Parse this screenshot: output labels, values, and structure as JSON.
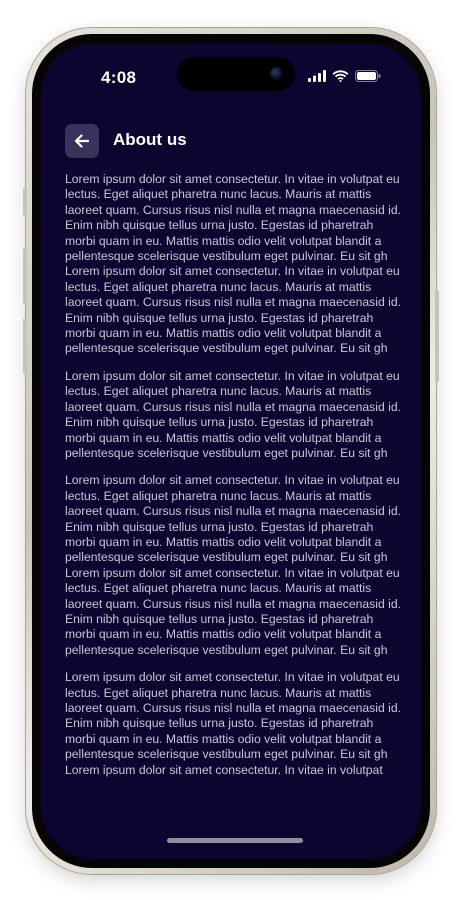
{
  "status_bar": {
    "time": "4:08",
    "icons": [
      "cellular-signal-icon",
      "wifi-icon",
      "battery-icon"
    ]
  },
  "header": {
    "back_icon": "arrow-left-icon",
    "title": "About us"
  },
  "colors": {
    "background": "#0d0430",
    "back_button": "#3a325c",
    "title": "#ffffff",
    "body_text": "#c9c6d6"
  },
  "content": {
    "paragraphs": [
      "Lorem ipsum dolor sit amet consectetur. In vitae in volutpat eu lectus. Eget aliquet pharetra nunc lacus. Mauris at mattis laoreet quam. Cursus risus nisl nulla et magna maecenasid id. Enim nibh quisque tellus urna justo. Egestas id pharetrah morbi quam in eu. Mattis mattis odio velit volutpat blandit a pellentesque scelerisque vestibulum eget pulvinar. Eu sit gh Lorem ipsum dolor sit amet consectetur. In vitae in volutpat eu lectus. Eget aliquet pharetra nunc lacus. Mauris at mattis laoreet quam. Cursus risus nisl nulla et magna maecenasid id. Enim nibh quisque tellus urna justo. Egestas id pharetrah morbi quam in eu. Mattis mattis odio velit volutpat blandit a pellentesque scelerisque vestibulum eget pulvinar. Eu sit gh",
      "Lorem ipsum dolor sit amet consectetur. In vitae in volutpat eu lectus. Eget aliquet pharetra nunc lacus. Mauris at mattis laoreet quam. Cursus risus nisl nulla et magna maecenasid id. Enim nibh quisque tellus urna justo. Egestas id pharetrah morbi quam in eu. Mattis mattis odio velit volutpat blandit a pellentesque scelerisque vestibulum eget pulvinar. Eu sit gh",
      "Lorem ipsum dolor sit amet consectetur. In vitae in volutpat eu lectus. Eget aliquet pharetra nunc lacus. Mauris at mattis laoreet quam. Cursus risus nisl nulla et magna maecenasid id. Enim nibh quisque tellus urna justo. Egestas id pharetrah morbi quam in eu. Mattis mattis odio velit volutpat blandit a pellentesque scelerisque vestibulum eget pulvinar. Eu sit gh Lorem ipsum dolor sit amet consectetur. In vitae in volutpat eu lectus. Eget aliquet pharetra nunc lacus. Mauris at mattis laoreet quam. Cursus risus nisl nulla et magna maecenasid id. Enim nibh quisque tellus urna justo. Egestas id pharetrah morbi quam in eu. Mattis mattis odio velit volutpat blandit a pellentesque scelerisque vestibulum eget pulvinar. Eu sit gh",
      "Lorem ipsum dolor sit amet consectetur. In vitae in volutpat eu lectus. Eget aliquet pharetra nunc lacus. Mauris at mattis laoreet quam. Cursus risus nisl nulla et magna maecenasid id. Enim nibh quisque tellus urna justo. Egestas id pharetrah morbi quam in eu. Mattis mattis odio velit volutpat blandit a pellentesque scelerisque vestibulum eget pulvinar. Eu sit gh Lorem ipsum dolor sit amet consectetur. In vitae in volutpat"
    ]
  }
}
